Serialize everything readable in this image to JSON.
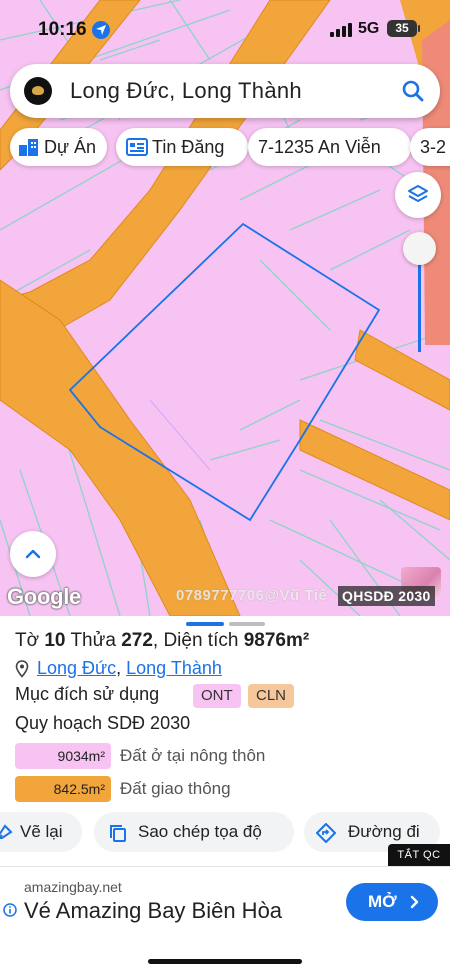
{
  "status_bar": {
    "time": "10:16",
    "network": "5G",
    "battery": "35",
    "icons": [
      "location-arrow-icon",
      "signal-bars-icon",
      "battery-icon"
    ]
  },
  "search": {
    "query": "Long Đức, Long Thành",
    "icons": [
      "app-logo-icon",
      "search-icon"
    ]
  },
  "chips": [
    {
      "label": "Dự Án",
      "icon": "building-icon"
    },
    {
      "label": "Tin Đăng",
      "icon": "listing-card-icon"
    },
    {
      "label": "7-1235 An Viễn",
      "icon": ""
    },
    {
      "label": "3-2",
      "icon": ""
    }
  ],
  "map": {
    "controls": [
      "layers-icon",
      "opacity-slider",
      "chevron-up-icon"
    ],
    "attribution": "Google",
    "watermark": "0789777706@Vũ Tiế",
    "layer_name": "QHSDĐ 2030",
    "colors": {
      "residential": "#f7c3f2",
      "road": "#f1a53a",
      "parcel_outline": "#1a73e8",
      "grid_lines": "#8fd3c9"
    }
  },
  "sheet": {
    "parcel_prefix": "Tờ",
    "sheet_no": "10",
    "plot_word": "Thửa",
    "plot_no": "272",
    "area_label": ", Diện tích",
    "area_value": "9876m²",
    "commune": "Long Đức",
    "separator": ",",
    "district": "Long Thành",
    "purpose_label": "Mục đích sử dụng",
    "purpose_tags": [
      "ONT",
      "CLN"
    ],
    "plan_title": "Quy hoạch SDĐ 2030",
    "legend": [
      {
        "area": "9034m²",
        "label": "Đất ở tại nông thôn",
        "color": "#f7c3f2"
      },
      {
        "area": "842.5m²",
        "label": "Đất giao thông",
        "color": "#f1a53a"
      }
    ],
    "actions": [
      {
        "label": "Vẽ lại",
        "icon": "redraw-icon"
      },
      {
        "label": "Sao chép tọa độ",
        "icon": "copy-icon"
      },
      {
        "label": "Đường đi",
        "icon": "directions-icon"
      }
    ]
  },
  "ad": {
    "close_label": "TẮT QC",
    "domain": "amazingbay.net",
    "headline": "Vé Amazing Bay Biên Hòa",
    "cta": "MỞ"
  }
}
